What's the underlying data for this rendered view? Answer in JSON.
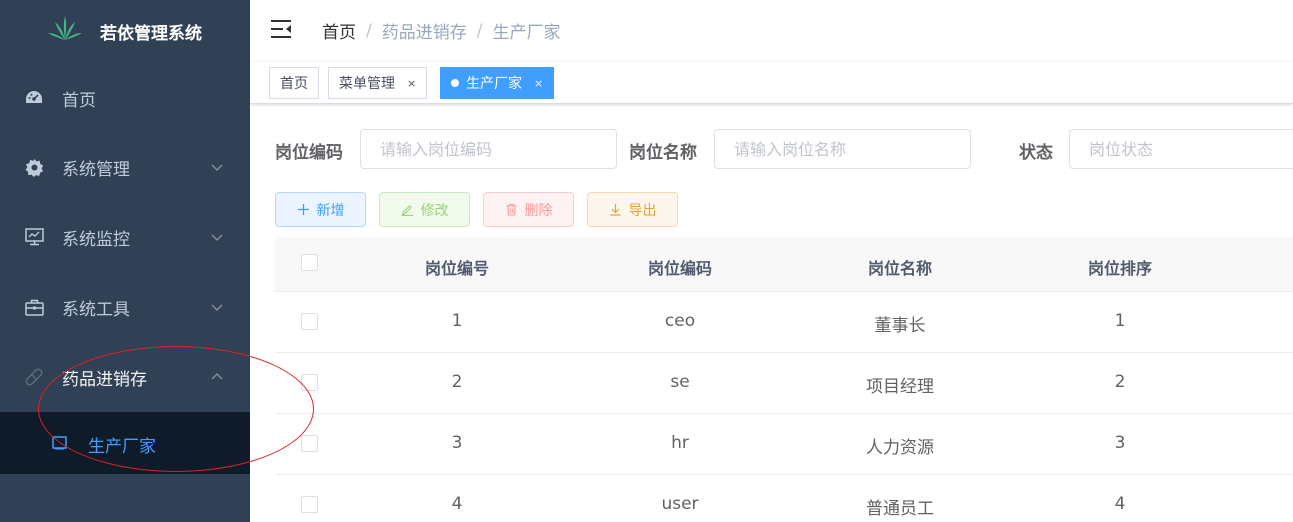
{
  "app": {
    "title": "若依管理系统"
  },
  "sidebar": {
    "items": [
      {
        "label": "首页",
        "icon": "dashboard-icon"
      },
      {
        "label": "系统管理",
        "icon": "gear-icon"
      },
      {
        "label": "系统监控",
        "icon": "monitor-icon"
      },
      {
        "label": "系统工具",
        "icon": "toolbox-icon"
      },
      {
        "label": "药品进销存",
        "icon": "pill-icon"
      }
    ],
    "submenu": {
      "label": "生产厂家",
      "icon": "square-icon"
    }
  },
  "breadcrumb": {
    "items": [
      "首页",
      "药品进销存",
      "生产厂家"
    ],
    "separator": "/"
  },
  "tags": [
    {
      "label": "首页"
    },
    {
      "label": "菜单管理",
      "close": "×"
    },
    {
      "label": "生产厂家",
      "close": "×",
      "active": true
    }
  ],
  "search": {
    "fields": [
      {
        "label": "岗位编码",
        "placeholder": "请输入岗位编码"
      },
      {
        "label": "岗位名称",
        "placeholder": "请输入岗位名称"
      },
      {
        "label": "状态",
        "placeholder": "岗位状态"
      }
    ]
  },
  "toolbar": {
    "add": "新增",
    "edit": "修改",
    "delete": "删除",
    "export": "导出"
  },
  "table": {
    "columns": [
      "岗位编号",
      "岗位编码",
      "岗位名称",
      "岗位排序"
    ],
    "rows": [
      [
        "1",
        "ceo",
        "董事长",
        "1"
      ],
      [
        "2",
        "se",
        "项目经理",
        "2"
      ],
      [
        "3",
        "hr",
        "人力资源",
        "3"
      ],
      [
        "4",
        "user",
        "普通员工",
        "4"
      ]
    ]
  },
  "colors": {
    "sidebar": "#304156",
    "accent": "#409eff",
    "annotation": "#e02020"
  }
}
